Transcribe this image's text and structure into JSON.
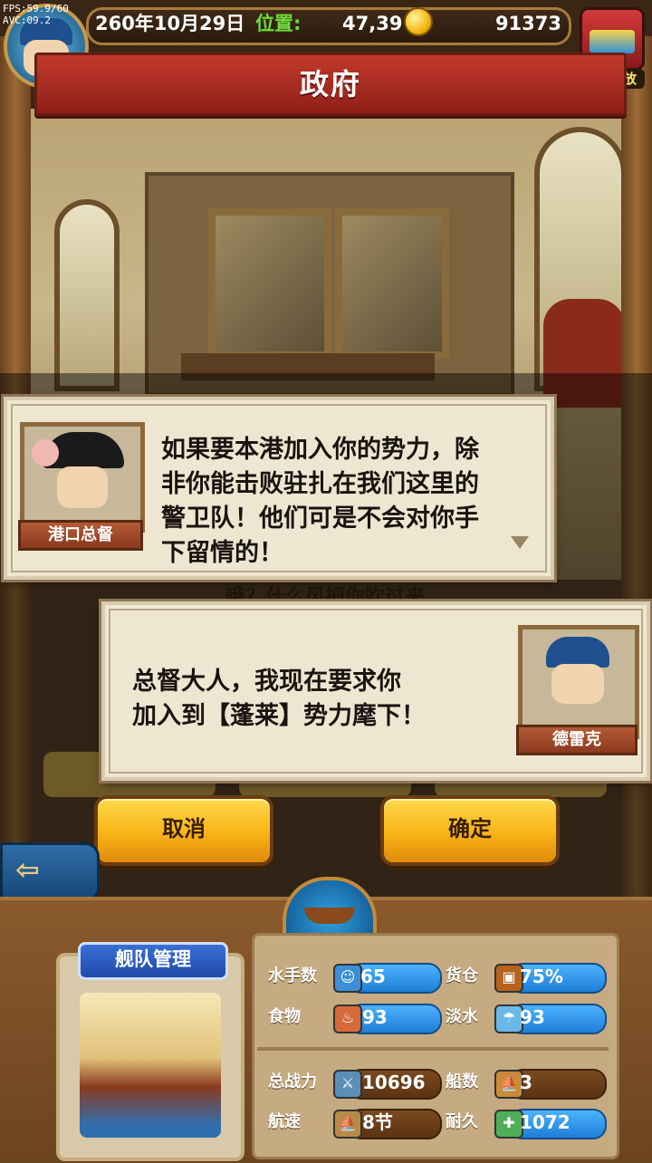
{
  "debug": {
    "fps": "FPS:59.9/60",
    "avc": "AVC:09.2"
  },
  "header": {
    "date": "260年10月29日",
    "position_label": "位置:",
    "position_value": "47,39",
    "gold": "91373",
    "chest_label": "暂不开放"
  },
  "title": "政府",
  "dialog_governor": {
    "name": "港口总督",
    "lines": [
      "如果要本港加入你的势力，除",
      "非你能击败驻扎在我们这里的",
      "警卫队！他们可是不会对你手",
      "下留情的！"
    ]
  },
  "background_text": "哦？什么风把你吹过来",
  "dialog_player": {
    "name": "德雷克",
    "lines": [
      "总督大人，我现在要求你",
      "加入到【蓬莱】势力麾下！"
    ]
  },
  "buttons": {
    "cancel": "取消",
    "confirm": "确定"
  },
  "fleet": {
    "label": "舰队管理",
    "stats": {
      "sailors": {
        "label": "水手数",
        "value": "65"
      },
      "cargo": {
        "label": "货仓",
        "value": "75%"
      },
      "food": {
        "label": "食物",
        "value": "93"
      },
      "water": {
        "label": "淡水",
        "value": "93"
      },
      "power": {
        "label": "总战力",
        "value": "10696"
      },
      "ships": {
        "label": "船数",
        "value": "3"
      },
      "speed": {
        "label": "航速",
        "value": "8节"
      },
      "durability": {
        "label": "耐久",
        "value": "1072"
      }
    }
  },
  "colors": {
    "accent_red": "#a82a20",
    "gold_button": "#f8b417",
    "pill_blue": "#1e7fd6"
  },
  "icons": [
    "gold-coin-icon",
    "treasure-chest-icon",
    "back-arrow-icon",
    "ship-icon",
    "sailor-icon",
    "cargo-icon",
    "food-icon",
    "water-icon",
    "power-icon",
    "ships-icon",
    "speed-icon",
    "durability-icon",
    "continue-arrow-icon"
  ]
}
